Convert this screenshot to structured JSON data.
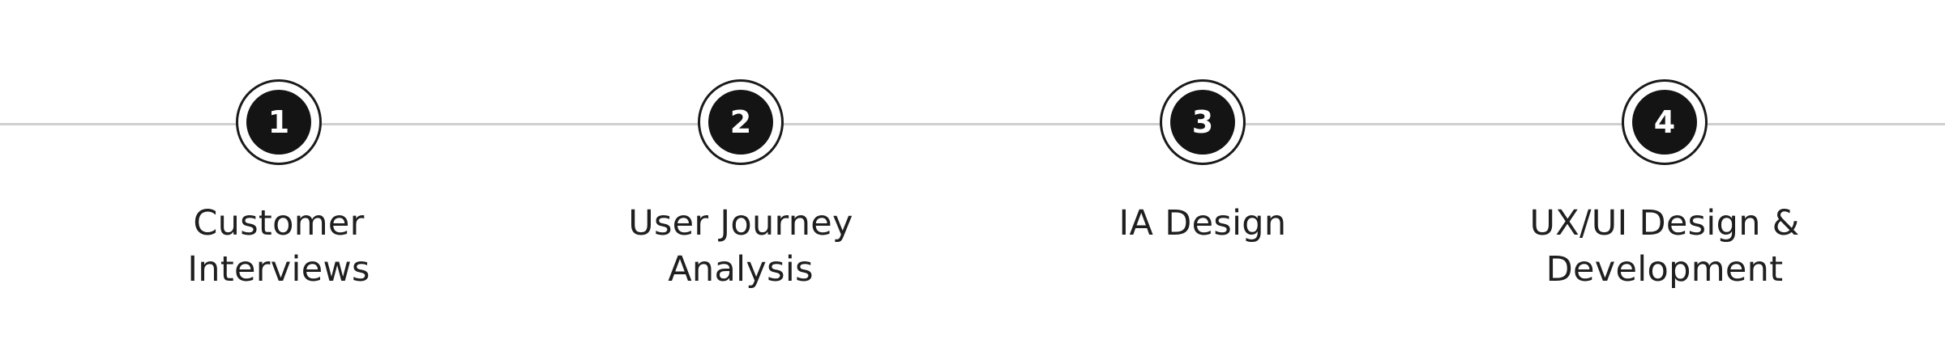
{
  "steps": [
    {
      "number": "1",
      "label_lines": [
        "Customer",
        "Interviews"
      ]
    },
    {
      "number": "2",
      "label_lines": [
        "User Journey",
        "Analysis"
      ]
    },
    {
      "number": "3",
      "label_lines": [
        "IA Design",
        ""
      ]
    },
    {
      "number": "4",
      "label_lines": [
        "UX/UI Design &",
        "Development"
      ]
    }
  ],
  "colors": {
    "line": "#cfcfcf",
    "marker_fill": "#141414",
    "marker_ring": "#1a1a1a",
    "text": "#1f1f1f"
  }
}
